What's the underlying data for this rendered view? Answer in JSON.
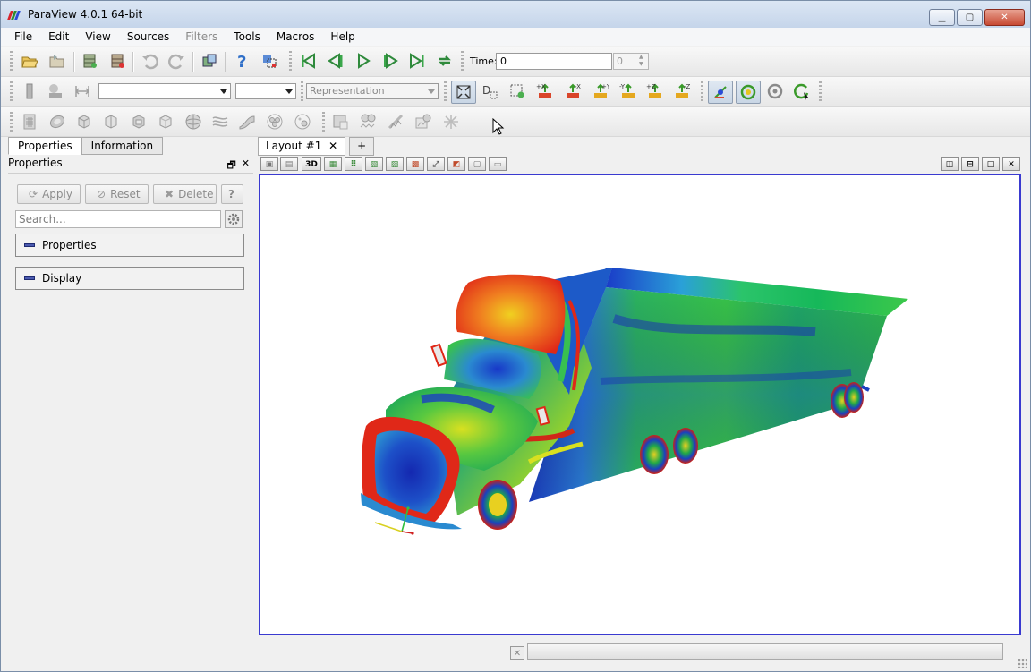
{
  "window": {
    "title": "ParaView 4.0.1 64-bit",
    "logo_colors": [
      "#d9242b",
      "#2e8b2e",
      "#2a4bd7"
    ]
  },
  "menubar": {
    "items": [
      {
        "label": "File",
        "enabled": true
      },
      {
        "label": "Edit",
        "enabled": true
      },
      {
        "label": "View",
        "enabled": true
      },
      {
        "label": "Sources",
        "enabled": true
      },
      {
        "label": "Filters",
        "enabled": false
      },
      {
        "label": "Tools",
        "enabled": true
      },
      {
        "label": "Macros",
        "enabled": true
      },
      {
        "label": "Help",
        "enabled": true
      }
    ]
  },
  "time": {
    "label": "Time:",
    "value": "0",
    "step": "0"
  },
  "toolbar2": {
    "representation_placeholder": "Representation",
    "axis_labels": [
      "+X",
      "-X",
      "+Y",
      "-Y",
      "+Z",
      "-Z"
    ]
  },
  "left_panel": {
    "tabs": [
      {
        "label": "Properties",
        "active": true
      },
      {
        "label": "Information",
        "active": false
      }
    ],
    "header": "Properties",
    "buttons": {
      "apply": "Apply",
      "reset": "Reset",
      "delete": "Delete",
      "help": "?"
    },
    "search_placeholder": "Search...",
    "sections": [
      "Properties",
      "Display"
    ]
  },
  "layout": {
    "tab_label": "Layout #1",
    "add_tab": "+",
    "view_3d_label": "3D"
  },
  "colors": {
    "accent_border": "#3a3ad0",
    "title_bar": "#c5d5ea"
  }
}
